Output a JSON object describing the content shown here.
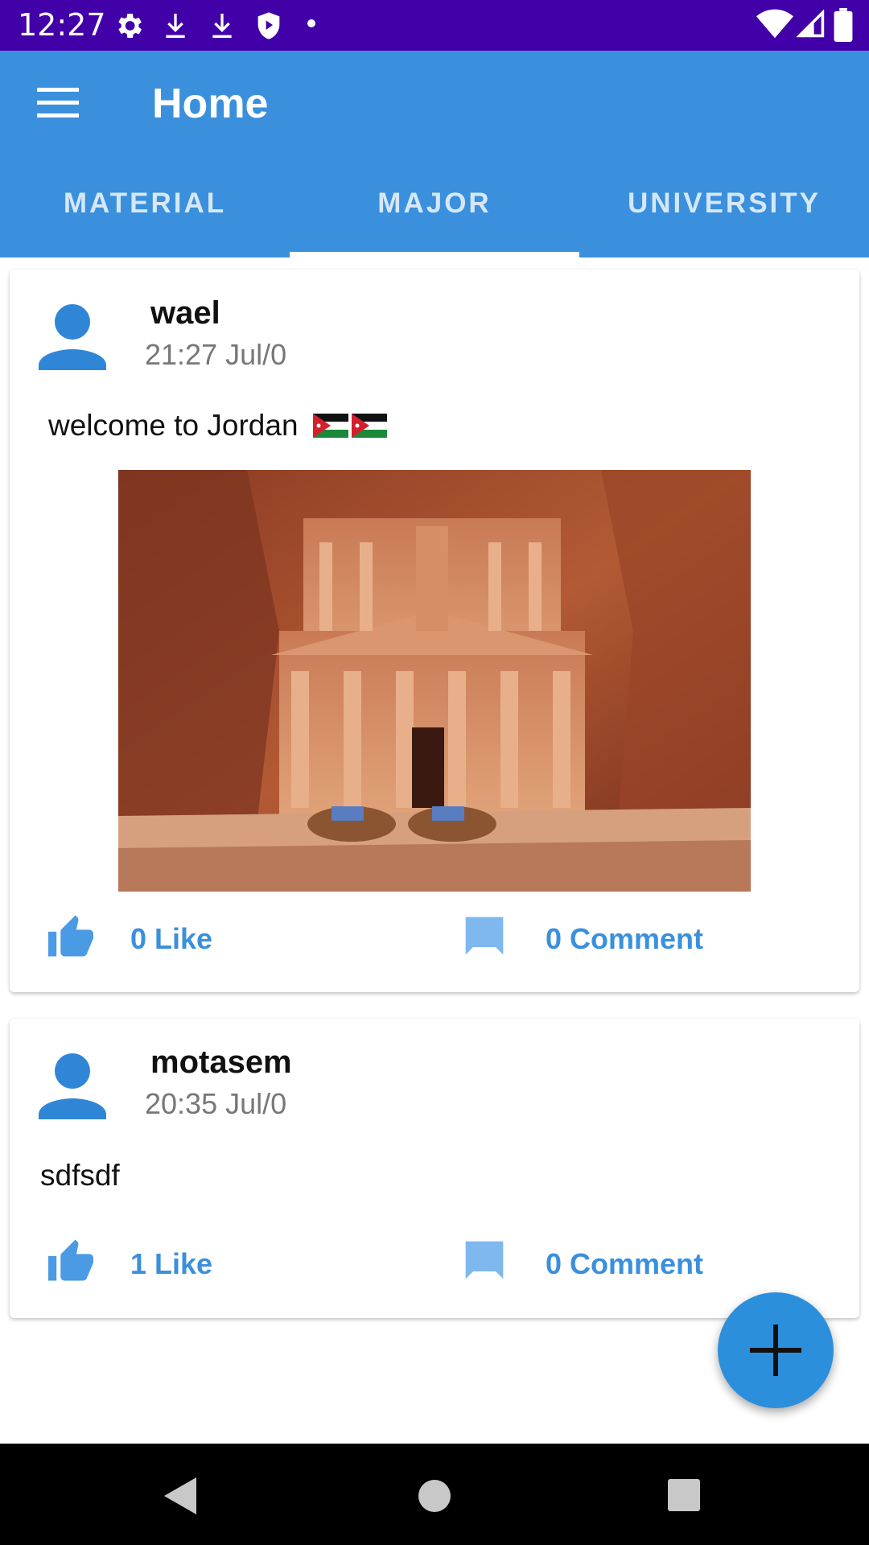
{
  "status_bar": {
    "time": "12:27",
    "left_icons": [
      "settings-icon",
      "download-icon",
      "download-icon",
      "shield-icon",
      "dot-icon"
    ],
    "right_icons": [
      "wifi-icon",
      "cellular-icon",
      "battery-icon"
    ]
  },
  "app_bar": {
    "title": "Home",
    "menu_icon": "hamburger-menu-icon",
    "color": "#3a90dc"
  },
  "tabs": [
    {
      "label": "MATERIAL",
      "selected": false
    },
    {
      "label": "MAJOR",
      "selected": true
    },
    {
      "label": "UNIVERSITY",
      "selected": false
    }
  ],
  "posts": [
    {
      "username": "wael",
      "time": "21:27 Jul/0",
      "text": "welcome to Jordan",
      "emoji": [
        "flag-jordan",
        "flag-jordan"
      ],
      "has_image": true,
      "like_label": "0 Like",
      "comment_label": "0 Comment"
    },
    {
      "username": "motasem",
      "time": "20:35 Jul/0",
      "text": "sdfsdf",
      "has_image": false,
      "like_label": "1 Like",
      "comment_label": "0 Comment"
    }
  ],
  "fab": {
    "icon": "plus-icon"
  },
  "nav_bar": {
    "icons": [
      "back-icon",
      "home-icon",
      "recents-icon"
    ]
  },
  "colors": {
    "status_bar": "#4100a8",
    "accent": "#3a90dc",
    "action_icon": "#7fb8ef"
  }
}
